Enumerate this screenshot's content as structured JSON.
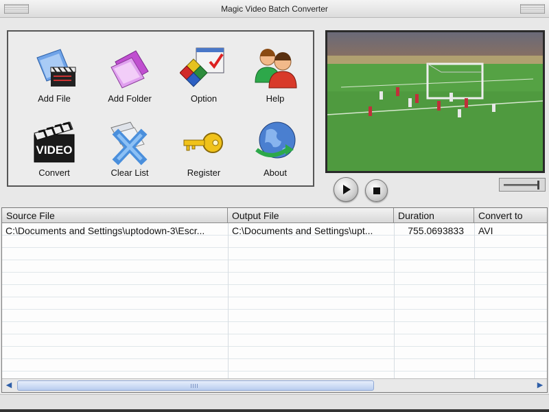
{
  "window": {
    "title": "Magic Video Batch Converter"
  },
  "toolbar": {
    "buttons": [
      {
        "label": "Add File",
        "icon": "add-file-icon"
      },
      {
        "label": "Add Folder",
        "icon": "add-folder-icon"
      },
      {
        "label": "Option",
        "icon": "option-icon"
      },
      {
        "label": "Help",
        "icon": "help-icon"
      },
      {
        "label": "Convert",
        "icon": "convert-icon"
      },
      {
        "label": "Clear List",
        "icon": "clear-list-icon"
      },
      {
        "label": "Register",
        "icon": "key-icon"
      },
      {
        "label": "About",
        "icon": "about-globe-icon"
      }
    ]
  },
  "player": {
    "play_icon": "play-icon",
    "stop_icon": "stop-icon",
    "volume_level": 0.95
  },
  "table": {
    "columns": [
      "Source File",
      "Output File",
      "Duration",
      "Convert to"
    ],
    "rows": [
      {
        "source": "C:\\Documents and Settings\\uptodown-3\\Escr...",
        "output": "C:\\Documents and Settings\\upt...",
        "duration": "755.0693833",
        "format": "AVI"
      }
    ]
  },
  "colors": {
    "accent": "#2f5fa8",
    "pitch_green": "#4f9a3f"
  }
}
